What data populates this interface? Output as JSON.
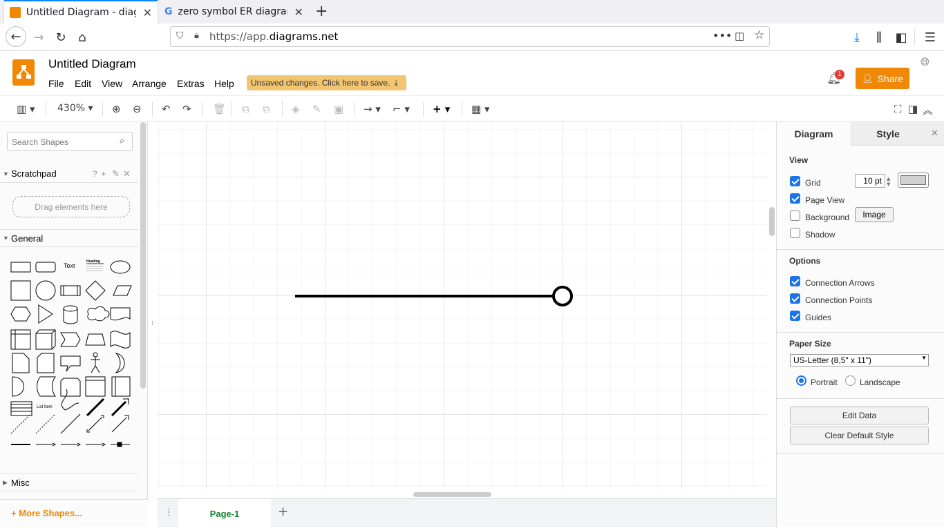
{
  "browser": {
    "tabs": [
      {
        "title": "Untitled Diagram - diagrams.net"
      },
      {
        "title": "zero symbol ER diagram - Google Search"
      }
    ],
    "url_host": "https://app.",
    "url_domain": "diagrams.net"
  },
  "app": {
    "title": "Untitled Diagram",
    "menus": [
      "File",
      "Edit",
      "View",
      "Arrange",
      "Extras",
      "Help"
    ],
    "unsaved_notice": "Unsaved changes. Click here to save.",
    "share_label": "Share",
    "notification_count": "1",
    "accent_color": "#f08705"
  },
  "toolbar": {
    "zoom": "430%"
  },
  "sidebar": {
    "search_placeholder": "Search Shapes",
    "scratchpad_title": "Scratchpad",
    "scratchpad_help": "?",
    "drag_hint": "Drag elements here",
    "general_title": "General",
    "shape_text_label": "Text",
    "shape_heading_label": "Heading",
    "shape_list_item_label": "List Item",
    "misc_title": "Misc",
    "more_shapes": "+ More Shapes..."
  },
  "pages": {
    "current": "Page-1"
  },
  "format_panel": {
    "tabs": [
      "Diagram",
      "Style"
    ],
    "view_title": "View",
    "grid_label": "Grid",
    "grid_size": "10 pt",
    "page_view_label": "Page View",
    "background_label": "Background",
    "image_button": "Image",
    "shadow_label": "Shadow",
    "options_title": "Options",
    "connection_arrows_label": "Connection Arrows",
    "connection_points_label": "Connection Points",
    "guides_label": "Guides",
    "paper_size_title": "Paper Size",
    "paper_size_value": "US-Letter (8,5\" x 11\")",
    "portrait_label": "Portrait",
    "landscape_label": "Landscape",
    "edit_data_button": "Edit Data",
    "clear_style_button": "Clear Default Style"
  }
}
